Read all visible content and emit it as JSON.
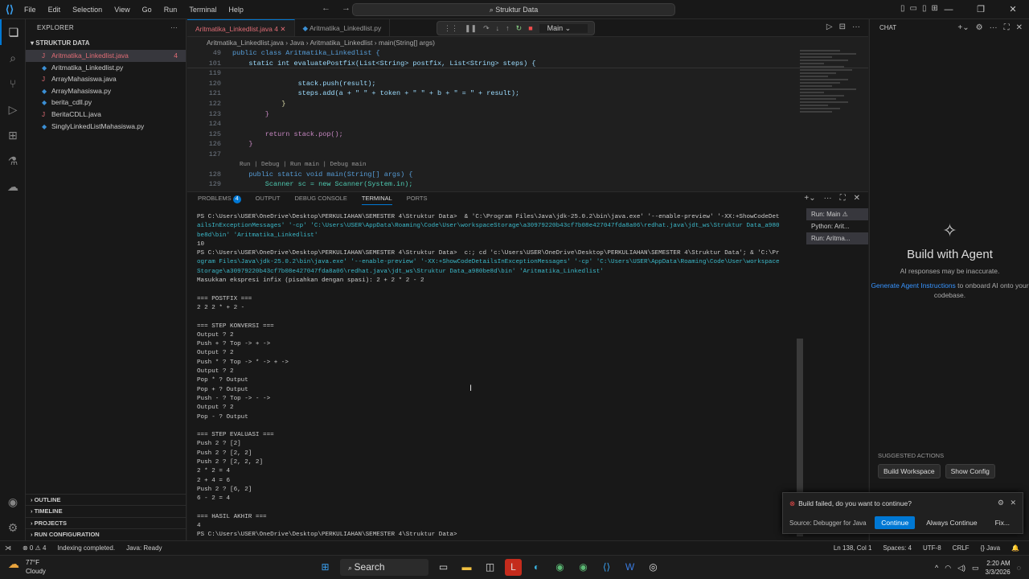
{
  "menu": [
    "File",
    "Edit",
    "Selection",
    "View",
    "Go",
    "Run",
    "Terminal",
    "Help"
  ],
  "search_label": "Struktur Data",
  "explorer": {
    "title": "EXPLORER",
    "folder": "STRUKTUR DATA",
    "files": [
      {
        "name": "Aritmatika_Linkedlist.java",
        "icon": "J",
        "badge": "4"
      },
      {
        "name": "Aritmatika_Linkedlist.py",
        "icon": "◆",
        "badge": ""
      },
      {
        "name": "ArrayMahasiswa.java",
        "icon": "J",
        "badge": ""
      },
      {
        "name": "ArrayMahasiswa.py",
        "icon": "◆",
        "badge": ""
      },
      {
        "name": "berita_cdll.py",
        "icon": "◆",
        "badge": ""
      },
      {
        "name": "BeritaCDLL.java",
        "icon": "J",
        "badge": ""
      },
      {
        "name": "SinglyLinkedListMahasiswa.py",
        "icon": "◆",
        "badge": ""
      }
    ],
    "sections": [
      "OUTLINE",
      "TIMELINE",
      "PROJECTS",
      "RUN CONFIGURATION"
    ]
  },
  "tabs": [
    "Aritmatika_Linkedlist.java 4",
    "Aritmatika_Linkedlist.py"
  ],
  "debug_config": "Main",
  "breadcrumbs": "Aritmatika_Linkedlist.java  ›  Java  ›  Aritmatika_Linkedlist  ›  main(String[] args)",
  "code": {
    "l49": "49",
    "l49t": "public class Aritmatika_Linkedlist {",
    "l101": "101",
    "l101t": "    static int evaluatePostfix(List<String> postfix, List<String> steps) {",
    "l119": "119",
    "l120": "120",
    "l120t": "                stack.push(result);",
    "l121": "121",
    "l121t": "                steps.add(a + \" \" + token + \" \" + b + \" = \" + result);",
    "l122": "122",
    "l122t": "            }",
    "l123": "123",
    "l123t": "        }",
    "l124": "124",
    "l125": "125",
    "l125t": "        return stack.pop();",
    "l126": "126",
    "l126t": "    }",
    "l127": "127",
    "lens": "Run | Debug | Run main | Debug main",
    "l128": "128",
    "l128t": "    public static void main(String[] args) {",
    "l129": "129",
    "l129t": "        Scanner sc = new Scanner(System.in);"
  },
  "panel": {
    "tabs": [
      "PROBLEMS",
      "OUTPUT",
      "DEBUG CONSOLE",
      "TERMINAL",
      "PORTS"
    ],
    "problems_count": "4"
  },
  "terminal": [
    "PS C:\\Users\\USER\\OneDrive\\Desktop\\PERKULIAHAN\\SEMESTER 4\\Struktur Data>  & 'C:\\Program Files\\Java\\jdk-25.0.2\\bin\\java.exe' '--enable-preview' '-XX:+ShowCodeDet",
    "ailsInExceptionMessages' '-cp' 'C:\\Users\\USER\\AppData\\Roaming\\Code\\User\\workspaceStorage\\a30979220b43cf7b08e427047fda8a06\\redhat.java\\jdt_ws\\Struktur Data_a980",
    "be8d\\bin' 'Aritmatika_Linkedlist'",
    "10",
    "PS C:\\Users\\USER\\OneDrive\\Desktop\\PERKULIAHAN\\SEMESTER 4\\Struktur Data>  c:; cd 'c:\\Users\\USER\\OneDrive\\Desktop\\PERKULIAHAN\\SEMESTER 4\\Struktur Data'; & 'C:\\Pr",
    "ogram Files\\Java\\jdk-25.0.2\\bin\\java.exe' '--enable-preview' '-XX:+ShowCodeDetailsInExceptionMessages' '-cp' 'C:\\Users\\USER\\AppData\\Roaming\\Code\\User\\workspace",
    "Storage\\a30979220b43cf7b08e427047fda8a06\\redhat.java\\jdt_ws\\Struktur Data_a980be8d\\bin' 'Aritmatika_Linkedlist'",
    "Masukkan ekspresi infix (pisahkan dengan spasi): 2 + 2 * 2 - 2",
    "",
    "=== POSTFIX ===",
    "2 2 2 * + 2 -",
    "",
    "=== STEP KONVERSI ===",
    "Output ? 2",
    "Push + ? Top -> + ->",
    "Output ? 2",
    "Push * ? Top -> * -> + ->",
    "Output ? 2",
    "Pop * ? Output",
    "Pop + ? Output",
    "Push - ? Top -> - ->",
    "Output ? 2",
    "Pop - ? Output",
    "",
    "=== STEP EVALUASI ===",
    "Push 2 ? [2]",
    "Push 2 ? [2, 2]",
    "Push 2 ? [2, 2, 2]",
    "2 * 2 = 4",
    "2 + 4 = 6",
    "Push 2 ? [6, 2]",
    "6 - 2 = 4",
    "",
    "=== HASIL AKHIR ===",
    "4",
    "PS C:\\Users\\USER\\OneDrive\\Desktop\\PERKULIAHAN\\SEMESTER 4\\Struktur Data> "
  ],
  "terminal_list": [
    "Run: Main ⚠",
    "Python: Arit...",
    "Run: Aritma..."
  ],
  "chat": {
    "title": "CHAT",
    "heading": "Build with Agent",
    "note": "AI responses may be inaccurate.",
    "link": "Generate Agent Instructions",
    "link_rest": " to onboard AI onto your codebase.",
    "suggested": "SUGGESTED ACTIONS",
    "actions": [
      "Build Workspace",
      "Show Config"
    ]
  },
  "toast": {
    "message": "Build failed, do you want to continue?",
    "source": "Source: Debugger for Java",
    "buttons": [
      "Continue",
      "Always Continue",
      "Fix..."
    ]
  },
  "status": {
    "left": [
      "⊗ 0 ⚠ 4",
      "Indexing completed.",
      "Java: Ready"
    ],
    "right": [
      "Ln 138, Col 1",
      "Spaces: 4",
      "UTF-8",
      "CRLF",
      "{} Java"
    ]
  },
  "weather": {
    "temp": "77°F",
    "cond": "Cloudy"
  },
  "taskbar_search": "Search",
  "clock": {
    "time": "2:20 AM",
    "date": "3/3/2026"
  }
}
